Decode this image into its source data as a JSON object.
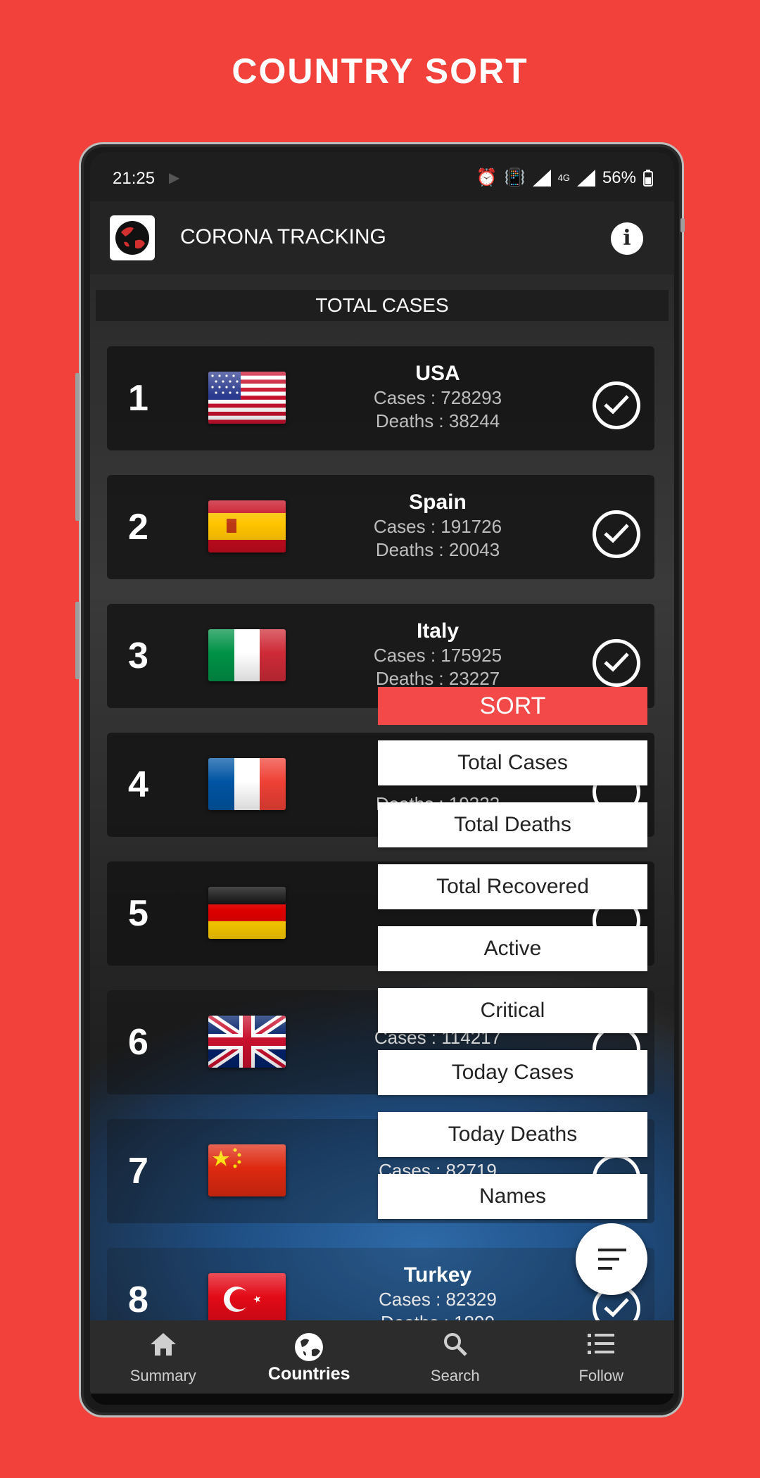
{
  "promo": {
    "title": "COUNTRY SORT"
  },
  "status_bar": {
    "time": "21:25",
    "battery": "56%",
    "network": "4G"
  },
  "app": {
    "title": "CORONA TRACKING"
  },
  "list": {
    "header": "TOTAL CASES",
    "rows": [
      {
        "rank": "1",
        "name": "USA",
        "cases": "Cases : 728293",
        "deaths": "Deaths : 38244",
        "flag": "us-flag-icon"
      },
      {
        "rank": "2",
        "name": "Spain",
        "cases": "Cases : 191726",
        "deaths": "Deaths : 20043",
        "flag": "spain-flag-icon"
      },
      {
        "rank": "3",
        "name": "Italy",
        "cases": "Cases : 175925",
        "deaths": "Deaths : 23227",
        "flag": "italy-flag-icon"
      },
      {
        "rank": "4",
        "name": "",
        "cases": "",
        "deaths": "Deaths : 19323",
        "flag": "france-flag-icon"
      },
      {
        "rank": "5",
        "name": "",
        "cases": "",
        "deaths": "",
        "flag": "germany-flag-icon"
      },
      {
        "rank": "6",
        "name": "",
        "cases": "Cases : 114217",
        "deaths": "",
        "flag": "uk-flag-icon"
      },
      {
        "rank": "7",
        "name": "",
        "cases": "Cases : 82719",
        "deaths": "",
        "flag": "china-flag-icon"
      },
      {
        "rank": "8",
        "name": "Turkey",
        "cases": "Cases : 82329",
        "deaths": "Deaths : 1890",
        "flag": "turkey-flag-icon"
      }
    ]
  },
  "sort_menu": {
    "header": "SORT",
    "options": [
      "Total Cases",
      "Total Deaths",
      "Total Recovered",
      "Active",
      "Critical",
      "Today Cases",
      "Today Deaths",
      "Names"
    ]
  },
  "bottom_nav": {
    "items": [
      {
        "label": "Summary",
        "icon": "home-icon"
      },
      {
        "label": "Countries",
        "icon": "globe-icon",
        "active": true
      },
      {
        "label": "Search",
        "icon": "search-icon"
      },
      {
        "label": "Follow",
        "icon": "list-icon"
      }
    ]
  },
  "colors": {
    "background": "#f2403a",
    "sort_header": "#f34a49",
    "app_bar": "#242424",
    "nav_bar": "#2c2c2c"
  }
}
